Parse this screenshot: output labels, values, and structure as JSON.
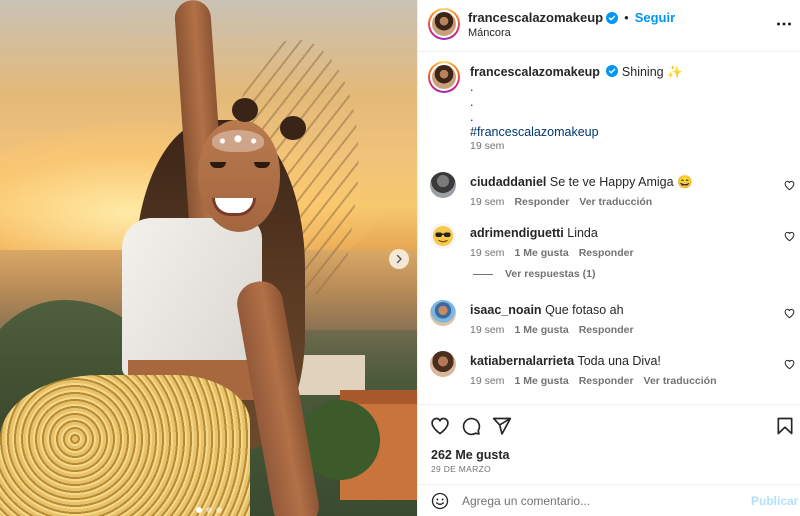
{
  "post": {
    "username": "francescalazomakeup",
    "follow_label": "Seguir",
    "header_separator": "•",
    "location": "Máncora",
    "caption_text": "Shining ✨",
    "caption_dots": [
      ".",
      ".",
      "."
    ],
    "caption_hashtag": "#francescalazomakeup",
    "caption_time": "19 sem"
  },
  "comments": [
    {
      "username": "ciudaddaniel",
      "text": "Se te ve Happy Amiga 😄",
      "time": "19 sem",
      "likes": "",
      "reply_label": "Responder",
      "translate_label": "Ver traducción"
    },
    {
      "username": "adrimendiguetti",
      "text": "Linda",
      "time": "19 sem",
      "likes": "1 Me gusta",
      "reply_label": "Responder",
      "translate_label": "",
      "view_replies": "Ver respuestas (1)"
    },
    {
      "username": "isaac_noain",
      "text": "Que fotaso ah",
      "time": "19 sem",
      "likes": "1 Me gusta",
      "reply_label": "Responder",
      "translate_label": ""
    },
    {
      "username": "katiabernalarrieta",
      "text": "Toda una Diva!",
      "time": "19 sem",
      "likes": "1 Me gusta",
      "reply_label": "Responder",
      "translate_label": "Ver traducción"
    }
  ],
  "stats": {
    "likes": "262 Me gusta",
    "date": "29 DE MARZO"
  },
  "comment_box": {
    "placeholder": "Agrega un comentario...",
    "publish_label": "Publicar"
  },
  "icons": {
    "verified": "verified-badge-icon",
    "more": "more-options-icon",
    "next": "chevron-right-icon",
    "like": "heart-icon",
    "comment": "comment-icon",
    "share": "paper-plane-icon",
    "save": "bookmark-icon",
    "emoji": "emoji-icon"
  },
  "colors": {
    "link_blue": "#0095f6",
    "hashtag": "#00376b",
    "muted": "#737373",
    "publish_disabled": "#b2dffc"
  },
  "carousel": {
    "slide_count": 3,
    "active_index": 0
  }
}
